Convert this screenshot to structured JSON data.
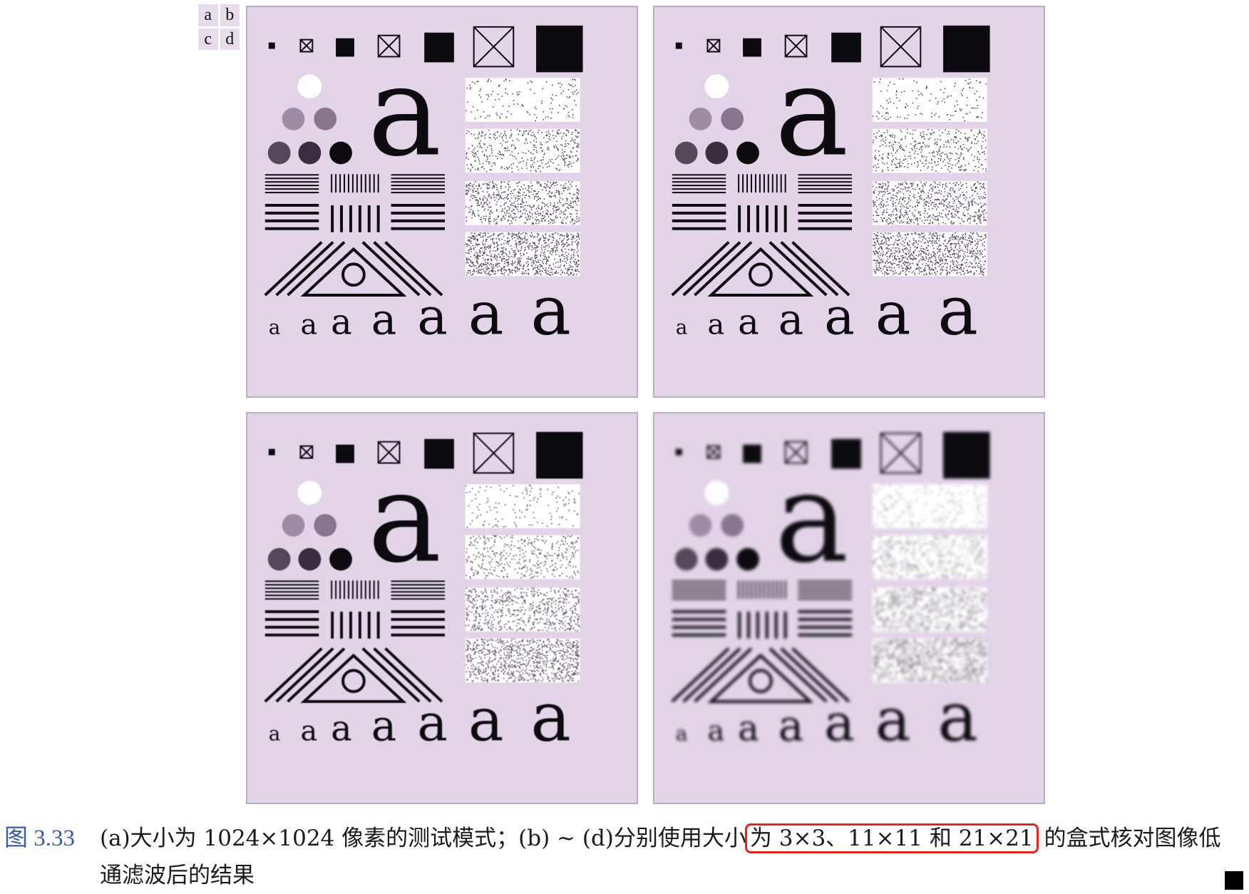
{
  "panel_key": {
    "a": "a",
    "b": "b",
    "c": "c",
    "d": "d"
  },
  "test_pattern": {
    "letter": "a"
  },
  "caption": {
    "label": "图 3.33",
    "text_before": "(a)大小为 1024×1024 像素的测试模式；(b) ~ (d)分别使用大小",
    "text_highlight": "为 3×3、11×11 和 21×21",
    "text_after": "的盒式核对图像低",
    "line2": "通滤波后的结果"
  },
  "colors": {
    "panel_bg": "#e3d4ea",
    "highlight": "#e0271e",
    "label": "#3b5ba8"
  }
}
